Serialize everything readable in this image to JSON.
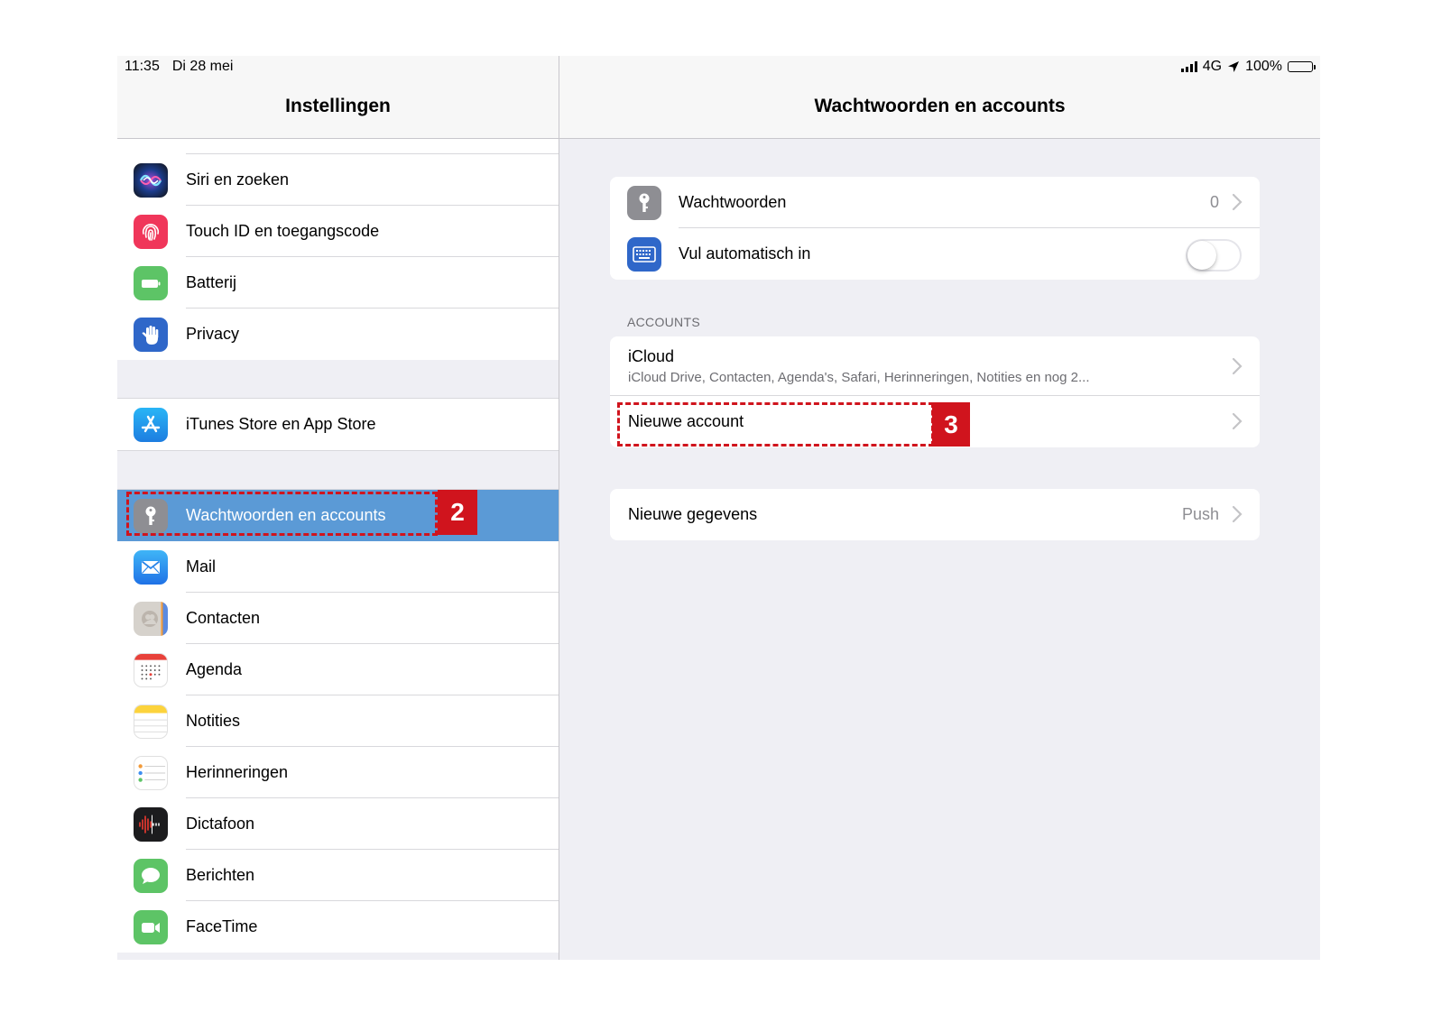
{
  "status_bar": {
    "time": "11:35",
    "date": "Di 28 mei",
    "network": "4G",
    "battery": "100%"
  },
  "sidebar": {
    "title": "Instellingen",
    "groups": [
      [
        {
          "label": "Siri en zoeken",
          "icon": "siri-icon"
        },
        {
          "label": "Touch ID en toegangscode",
          "icon": "fingerprint-icon"
        },
        {
          "label": "Batterij",
          "icon": "battery-icon"
        },
        {
          "label": "Privacy",
          "icon": "hand-icon"
        }
      ],
      [
        {
          "label": "iTunes Store en App Store",
          "icon": "app-store-icon"
        }
      ],
      [
        {
          "label": "Wachtwoorden en accounts",
          "icon": "key-icon",
          "selected": true
        },
        {
          "label": "Mail",
          "icon": "mail-icon"
        },
        {
          "label": "Contacten",
          "icon": "contacts-icon"
        },
        {
          "label": "Agenda",
          "icon": "calendar-icon"
        },
        {
          "label": "Notities",
          "icon": "notes-icon"
        },
        {
          "label": "Herinneringen",
          "icon": "reminders-icon"
        },
        {
          "label": "Dictafoon",
          "icon": "voice-memo-icon"
        },
        {
          "label": "Berichten",
          "icon": "messages-icon"
        },
        {
          "label": "FaceTime",
          "icon": "facetime-icon"
        }
      ]
    ]
  },
  "detail": {
    "title": "Wachtwoorden en accounts",
    "passwords_label": "Wachtwoorden",
    "passwords_count": "0",
    "autofill_label": "Vul automatisch in",
    "accounts_header": "ACCOUNTS",
    "icloud_title": "iCloud",
    "icloud_subtitle": "iCloud Drive, Contacten, Agenda's, Safari, Herinneringen, Notities en nog 2...",
    "new_account_label": "Nieuwe account",
    "fetch_label": "Nieuwe gegevens",
    "fetch_value": "Push"
  },
  "annotations": {
    "step2": "2",
    "step3": "3"
  },
  "colors": {
    "selected_row": "#5b9ad6",
    "annotation": "#d0141d",
    "background": "#efeff4"
  }
}
